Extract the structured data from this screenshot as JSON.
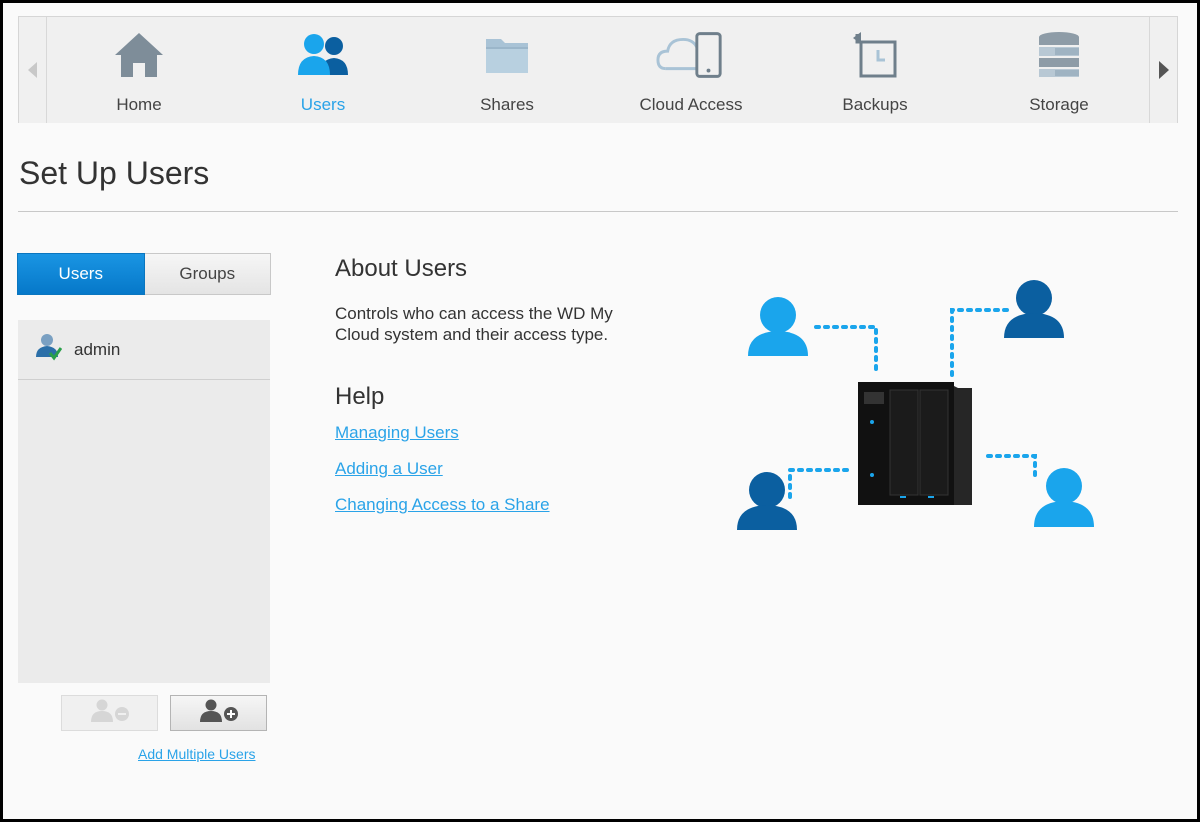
{
  "nav": {
    "items": [
      {
        "label": "Home",
        "icon": "home-icon"
      },
      {
        "label": "Users",
        "icon": "users-icon",
        "active": true
      },
      {
        "label": "Shares",
        "icon": "folder-icon"
      },
      {
        "label": "Cloud Access",
        "icon": "cloud-device-icon"
      },
      {
        "label": "Backups",
        "icon": "backup-icon"
      },
      {
        "label": "Storage",
        "icon": "storage-icon"
      }
    ],
    "prev_icon": "chevron-left-icon",
    "next_icon": "chevron-right-icon"
  },
  "page": {
    "title": "Set Up Users"
  },
  "left_panel": {
    "tabs": [
      {
        "label": "Users",
        "active": true
      },
      {
        "label": "Groups",
        "active": false
      }
    ],
    "users": [
      {
        "name": "admin",
        "icon": "admin-user-icon"
      }
    ],
    "remove_user_icon": "remove-user-icon",
    "add_user_icon": "add-user-icon",
    "add_multiple_link": "Add Multiple Users"
  },
  "about": {
    "title": "About Users",
    "text": "Controls who can access the WD My Cloud system and their access type."
  },
  "help": {
    "title": "Help",
    "links": [
      "Managing Users",
      "Adding a User",
      "Changing Access to a Share"
    ]
  },
  "colors": {
    "accent": "#2aa3e8",
    "active_tab": "#0a87d9",
    "light_user": "#1aa5ec",
    "dark_user": "#0b5fa0"
  }
}
